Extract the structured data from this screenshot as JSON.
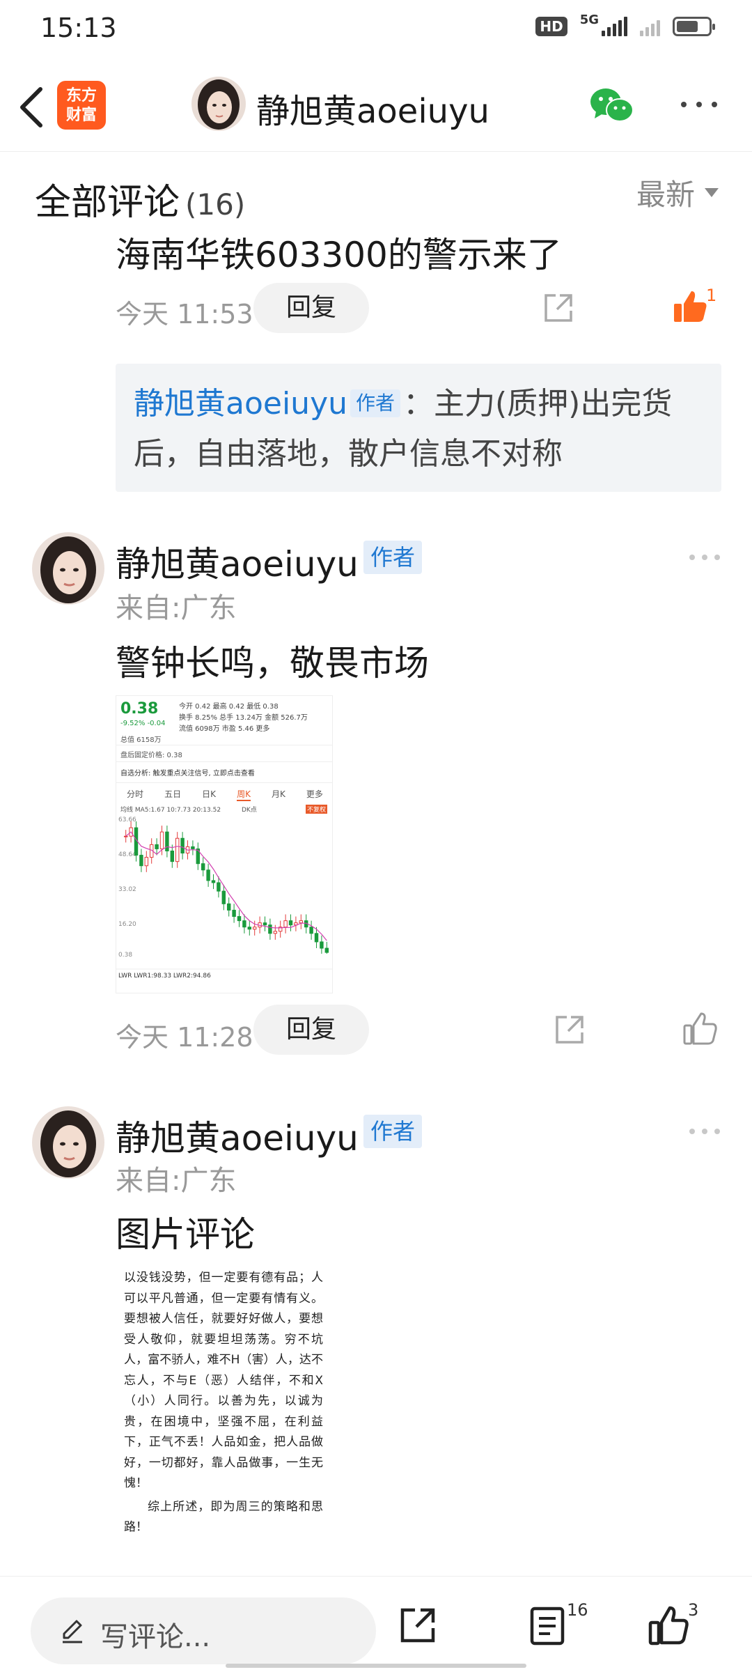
{
  "status_bar": {
    "time": "15:13",
    "network_badge": "HD",
    "network_type": "5G",
    "icons": [
      "hd-icon",
      "signal-icon",
      "signal-dim-icon",
      "battery-icon"
    ]
  },
  "header": {
    "logo_text": "东方财富",
    "logo_line1": "东方",
    "logo_line2": "财富",
    "user_name": "静旭黄aoeiuyu",
    "icons": [
      "back-icon",
      "wechat-icon",
      "more-icon"
    ]
  },
  "section": {
    "title": "全部评论",
    "count": "(16)",
    "sort_label": "最新"
  },
  "comments": [
    {
      "text": "海南华铁603300的警示来了",
      "time": "今天 11:53",
      "reply_label": "回复",
      "like_count": "1",
      "liked": true,
      "quote": {
        "author": "静旭黄aoeiuyu",
        "tag": "作者",
        "text": "：主力(质押)出完货后，自由落地，散户信息不对称"
      }
    },
    {
      "user_name": "静旭黄aoeiuyu",
      "tag": "作者",
      "from": "来自:广东",
      "text": "警钟长鸣，敬畏市场",
      "time": "今天 11:28",
      "reply_label": "回复"
    },
    {
      "user_name": "静旭黄aoeiuyu",
      "tag": "作者",
      "from": "来自:广东",
      "text": "图片评论"
    }
  ],
  "stock_image": {
    "price": "0.38",
    "change_pct": "-9.52%",
    "change_abs": "-0.04",
    "stats_row1": "今开 0.42  最高 0.42  最低 0.38",
    "stats_row2": "换手 8.25%  总手 13.24万  金额 526.7万",
    "stats_row3": "流值 6098万  市盈 5.46  更多",
    "total_label": "总值 6158万",
    "after_hours": "盘后固定价格: 0.38",
    "ad_text": "自选分析: 触发重点关注信号, 立即点击查看",
    "tabs": [
      "分时",
      "五日",
      "日K",
      "周K",
      "月K",
      "更多"
    ],
    "ma_text": "均线  MA5:1.67  10:7.73  20:13.52",
    "dk_label": "DK点",
    "fq_label": "不复权",
    "y_labels": [
      "63.66",
      "48.64",
      "33.02",
      "16.20",
      "0.38"
    ],
    "lwr_text": "LWR  LWR1:98.33  LWR2:94.86",
    "lwr_value": "98.33",
    "weekly_close": [
      56,
      60,
      47,
      42,
      46,
      52,
      50,
      58,
      49,
      44,
      55,
      48,
      51,
      50,
      43,
      40,
      35,
      34,
      30,
      24,
      21,
      18,
      16,
      13,
      12,
      13,
      15,
      14,
      10,
      11,
      13,
      16,
      14,
      15,
      16,
      13,
      10,
      6,
      3,
      1
    ]
  },
  "text_image": {
    "paragraph1": "以没钱没势，但一定要有德有品；人可以平凡普通，但一定要有情有义。要想被人信任，就要好好做人，要想受人敬仰，就要坦坦荡荡。穷不坑人，富不骄人，难不H（害）人，达不忘人，不与E（恶）人结伴，不和X（小）人同行。以善为先，以诚为贵，在困境中，坚强不屈，在利益下，正气不丢！人品如金，把人品做好，一切都好，靠人品做事，一生无愧！",
    "paragraph2": "综上所述，即为周三的策略和思路！"
  },
  "bottom_bar": {
    "comment_placeholder": "写评论...",
    "comment_count": "16",
    "like_count": "3",
    "icons": [
      "pen-icon",
      "share-icon",
      "comments-icon",
      "thumbs-up-icon"
    ]
  },
  "colors": {
    "brand": "#ff5a1f",
    "author_blue": "#1f78d1",
    "like_orange": "#ff6a1f",
    "stock_green": "#1a9a3c"
  }
}
